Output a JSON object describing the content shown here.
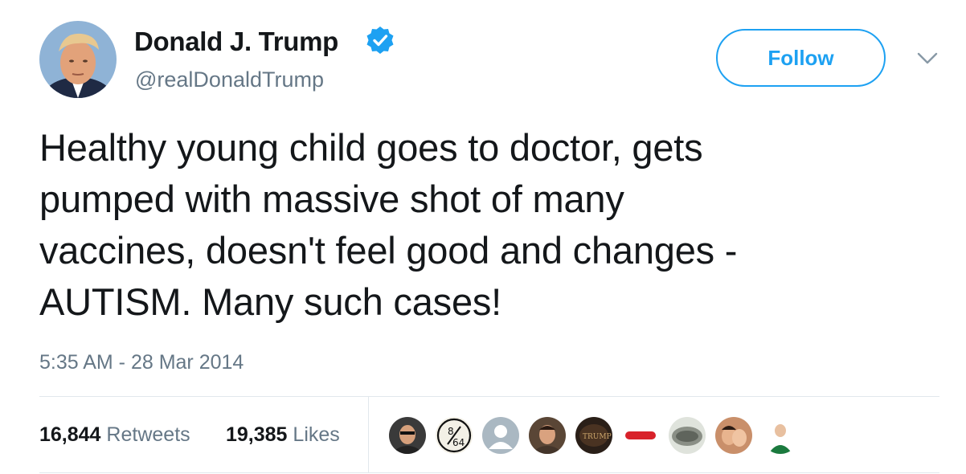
{
  "author": {
    "display_name": "Donald J. Trump",
    "handle": "@realDonaldTrump",
    "verified": true,
    "avatar_icon": "profile-photo"
  },
  "follow_button": {
    "label": "Follow"
  },
  "menu_icon": "chevron-down-icon",
  "tweet": {
    "lines": [
      "Healthy young child goes to doctor, gets",
      "pumped with massive shot of many",
      "vaccines, doesn't feel good and changes -",
      "AUTISM. Many such cases!"
    ],
    "timestamp": "5:35 AM - 28 Mar 2014"
  },
  "stats": {
    "retweets": {
      "count": "16,844",
      "label": "Retweets"
    },
    "likes": {
      "count": "19,385",
      "label": "Likes"
    }
  },
  "likers": [
    {
      "name": "liker-avatar-1",
      "bg": "#3a3a3a"
    },
    {
      "name": "liker-avatar-2",
      "text": "8/64",
      "bg": "#f3f0e6"
    },
    {
      "name": "liker-avatar-3",
      "bg": "#aab8c2"
    },
    {
      "name": "liker-avatar-4",
      "bg": "#5a4636"
    },
    {
      "name": "liker-avatar-5",
      "text": "TRUMP",
      "bg": "#2a1f18"
    },
    {
      "name": "liker-avatar-6",
      "bg": "#d8222a"
    },
    {
      "name": "liker-avatar-7",
      "bg": "#8a8f86"
    },
    {
      "name": "liker-avatar-8",
      "bg": "#c98f6a"
    },
    {
      "name": "liker-avatar-9",
      "bg": "#e9e0d4"
    }
  ],
  "colors": {
    "accent": "#1da1f2",
    "text": "#14171a",
    "muted": "#657786",
    "divider": "#e1e8ed"
  }
}
